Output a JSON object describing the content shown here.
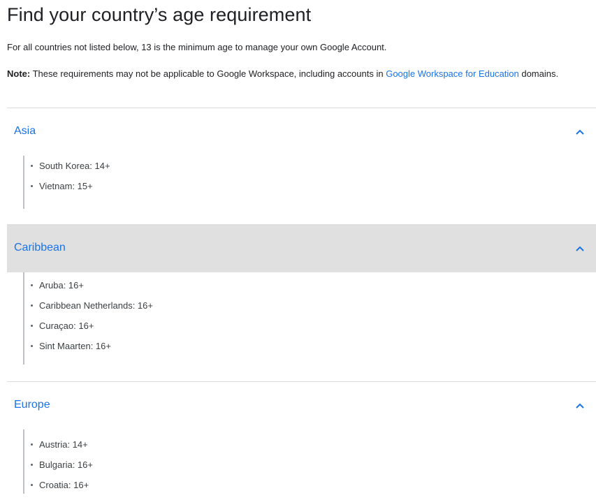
{
  "title": "Find your country’s age requirement",
  "intro": "For all countries not listed below, 13 is the minimum age to manage your own Google Account.",
  "note": {
    "label": "Note:",
    "text_before_link": " These requirements may not be applicable to Google Workspace, including accounts in ",
    "link_text": "Google Workspace for Education",
    "text_after_link": " domains."
  },
  "regions": [
    {
      "name": "Asia",
      "expanded": true,
      "items": [
        "South Korea: 14+",
        "Vietnam: 15+"
      ]
    },
    {
      "name": "Caribbean",
      "expanded": true,
      "hovered": true,
      "items": [
        "Aruba: 16+",
        "Caribbean Netherlands: 16+",
        "Curaçao: 16+",
        "Sint Maarten: 16+"
      ]
    },
    {
      "name": "Europe",
      "expanded": true,
      "items": [
        "Austria: 14+",
        "Bulgaria: 16+",
        "Croatia: 16+"
      ]
    }
  ],
  "icons": {
    "accordion_toggle": "chevron-up-icon"
  },
  "colors": {
    "link": "#1a73e8",
    "hover_background": "#e0e0e0",
    "divider": "#dadce0"
  }
}
